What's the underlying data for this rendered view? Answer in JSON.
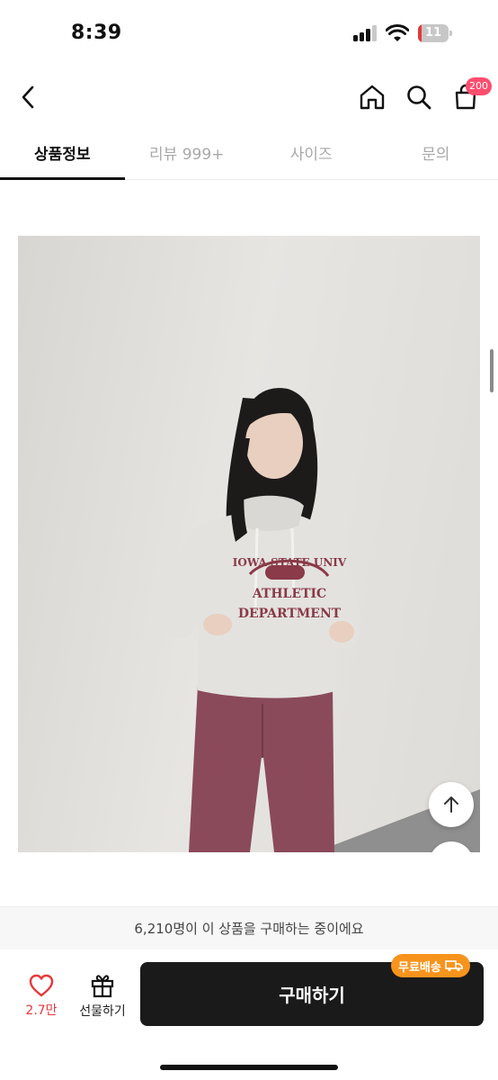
{
  "status_bar": {
    "time": "8:39",
    "battery_level": "11",
    "battery_fraction": 0.11,
    "battery_color": "#e5383b",
    "signal_bars_active": 3
  },
  "header": {
    "icons": [
      "chevron-left-icon",
      "home-icon",
      "search-icon",
      "shopping-bag-icon"
    ],
    "cart_badge": "200",
    "badge_color": "#ff4d6d"
  },
  "tabs": [
    {
      "label": "상품정보",
      "active": true
    },
    {
      "label": "리뷰 999+",
      "active": false
    },
    {
      "label": "사이즈",
      "active": false
    },
    {
      "label": "문의",
      "active": false
    }
  ],
  "photo": {
    "sweatshirt_text": [
      "IOWA STATE UNIV",
      "ATHLETIC",
      "DEPARTMENT"
    ]
  },
  "purchase_notice": "6,210명이 이 상품을 구매하는 중이에요",
  "actions": {
    "like_count": "2.7만",
    "gift_label": "선물하기",
    "buy_label": "구매하기",
    "free_shipping_label": "무료배송",
    "accent_color": "#f7941d"
  }
}
